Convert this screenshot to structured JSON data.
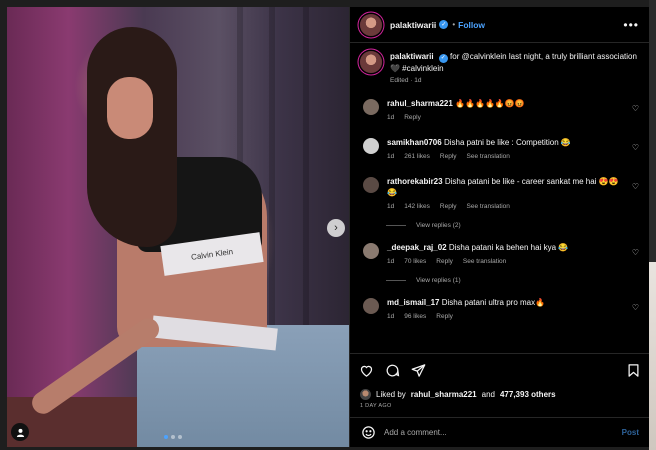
{
  "post": {
    "username": "palaktiwarii",
    "follow_label": "Follow",
    "separator": "•",
    "more_label": "•••",
    "photo_band_text": "Calvin Klein",
    "carousel_dots": 3,
    "carousel_active": 0
  },
  "caption": {
    "username": "palaktiwarii",
    "text": "for @calvinklein last night, a truly brilliant association 🖤 #calvinklein",
    "meta": "Edited · 1d"
  },
  "comments": [
    {
      "username": "rahul_sharma221",
      "text": "🔥🔥🔥🔥🔥😡😡",
      "time": "1d",
      "likes": "",
      "reply": "Reply",
      "translate": "",
      "avatar_color": "#7a6a60"
    },
    {
      "username": "samikhan0706",
      "text": "Disha patni be like : Competition 😂",
      "time": "1d",
      "likes": "261 likes",
      "reply": "Reply",
      "translate": "See translation",
      "avatar_color": "#d0d0d0"
    },
    {
      "username": "rathorekabir23",
      "text": "Disha patani be like - career sankat me hai 😍😍😂",
      "time": "1d",
      "likes": "142 likes",
      "reply": "Reply",
      "translate": "See translation",
      "avatar_color": "#5a4a44",
      "replies": "View replies (2)"
    },
    {
      "username": "_deepak_raj_02",
      "text": "Disha patani ka behen hai kya 😂",
      "time": "1d",
      "likes": "70 likes",
      "reply": "Reply",
      "translate": "See translation",
      "avatar_color": "#8a7a70",
      "replies": "View replies (1)"
    },
    {
      "username": "md_ismail_17",
      "text": "Disha patani ultra pro max🔥",
      "time": "1d",
      "likes": "96 likes",
      "reply": "Reply",
      "translate": "",
      "avatar_color": "#6b5a52"
    }
  ],
  "likes": {
    "prefix": "Liked by",
    "user": "rahul_sharma221",
    "and": "and",
    "count": "477,393 others"
  },
  "date": "1 DAY AGO",
  "add_comment": {
    "placeholder": "Add a comment...",
    "post_label": "Post"
  },
  "icons": [
    "verified-badge",
    "more-icon",
    "heart-icon",
    "comment-icon",
    "share-icon",
    "save-icon",
    "emoji-icon",
    "tag-user-icon",
    "next-arrow-icon"
  ]
}
